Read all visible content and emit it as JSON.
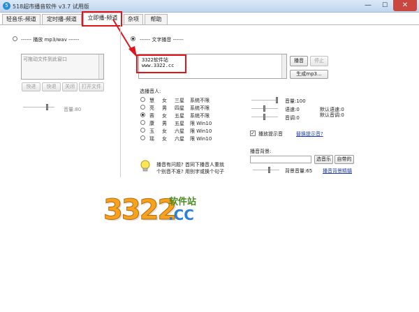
{
  "window": {
    "icon_glyph": "5",
    "title": "518超市播音软件 v3.7 试用版",
    "min_glyph": "—",
    "max_glyph": "☐",
    "close_glyph": "✕"
  },
  "tabs": [
    {
      "label": "轻音乐-频道"
    },
    {
      "label": "定时播-频道"
    },
    {
      "label": "立即播-频道",
      "active": true
    },
    {
      "label": "杂项"
    },
    {
      "label": "帮助"
    }
  ],
  "left_panel": {
    "radio_label": "------ 播放 mp3/wav ------",
    "drop_placeholder": "可拖动文件到此窗口",
    "buttons": [
      "快进",
      "快退",
      "关闭",
      "打开文件"
    ],
    "volume_label": "音量:80",
    "volume_fraction": 0.8
  },
  "right_panel": {
    "radio_label": "------ 文字播音 ------",
    "text_lines": [
      "3322软件站",
      "www.3322.cc"
    ],
    "play_button": "播音",
    "stop_button": "停止",
    "gen_button": "生成mp3...",
    "voice_section_label": "选播音人:",
    "voices": [
      {
        "name": "慧",
        "gender": "女",
        "stars": "三星",
        "system": "系统不限",
        "selected": false
      },
      {
        "name": "亮",
        "gender": "男",
        "stars": "四星",
        "system": "系统不限",
        "selected": false
      },
      {
        "name": "蓉",
        "gender": "女",
        "stars": "五星",
        "system": "系统不限",
        "selected": true
      },
      {
        "name": "康",
        "gender": "男",
        "stars": "五星",
        "system": "限 Win10",
        "selected": false
      },
      {
        "name": "玉",
        "gender": "女",
        "stars": "六星",
        "system": "限 Win10",
        "selected": false
      },
      {
        "name": "瑶",
        "gender": "女",
        "stars": "六星",
        "system": "限 Win10",
        "selected": false
      }
    ],
    "volume_label": "音量:100",
    "speed_label": "语速:0",
    "pitch_label": "音调:0",
    "default_speed_label": "默认语速:0",
    "default_pitch_label": "默认音调:0",
    "chime_checkbox_label": "播放提示音",
    "chime_checked": true,
    "change_chime_link": "替换提示音?",
    "bg_label": "播音背景:",
    "choose_music_button": "选音乐",
    "builtin_button": "自带的",
    "bg_volume_label": "背景音量:65",
    "bg_volume_fraction": 0.65,
    "tips_link": "播音背景精髓",
    "hint_line1": "播音有问题? 首同下播音人重就",
    "hint_line2": "个别音不准? 用别字或换个句子"
  },
  "watermark": {
    "number": "3322",
    "domain": ".CC",
    "name": "软件站"
  },
  "colors": {
    "highlight": "#e0141b",
    "link": "#1e3fa8",
    "logo_orange": "#f6a21e",
    "logo_blue": "#2b7fd6",
    "logo_green": "#4a8a22"
  }
}
